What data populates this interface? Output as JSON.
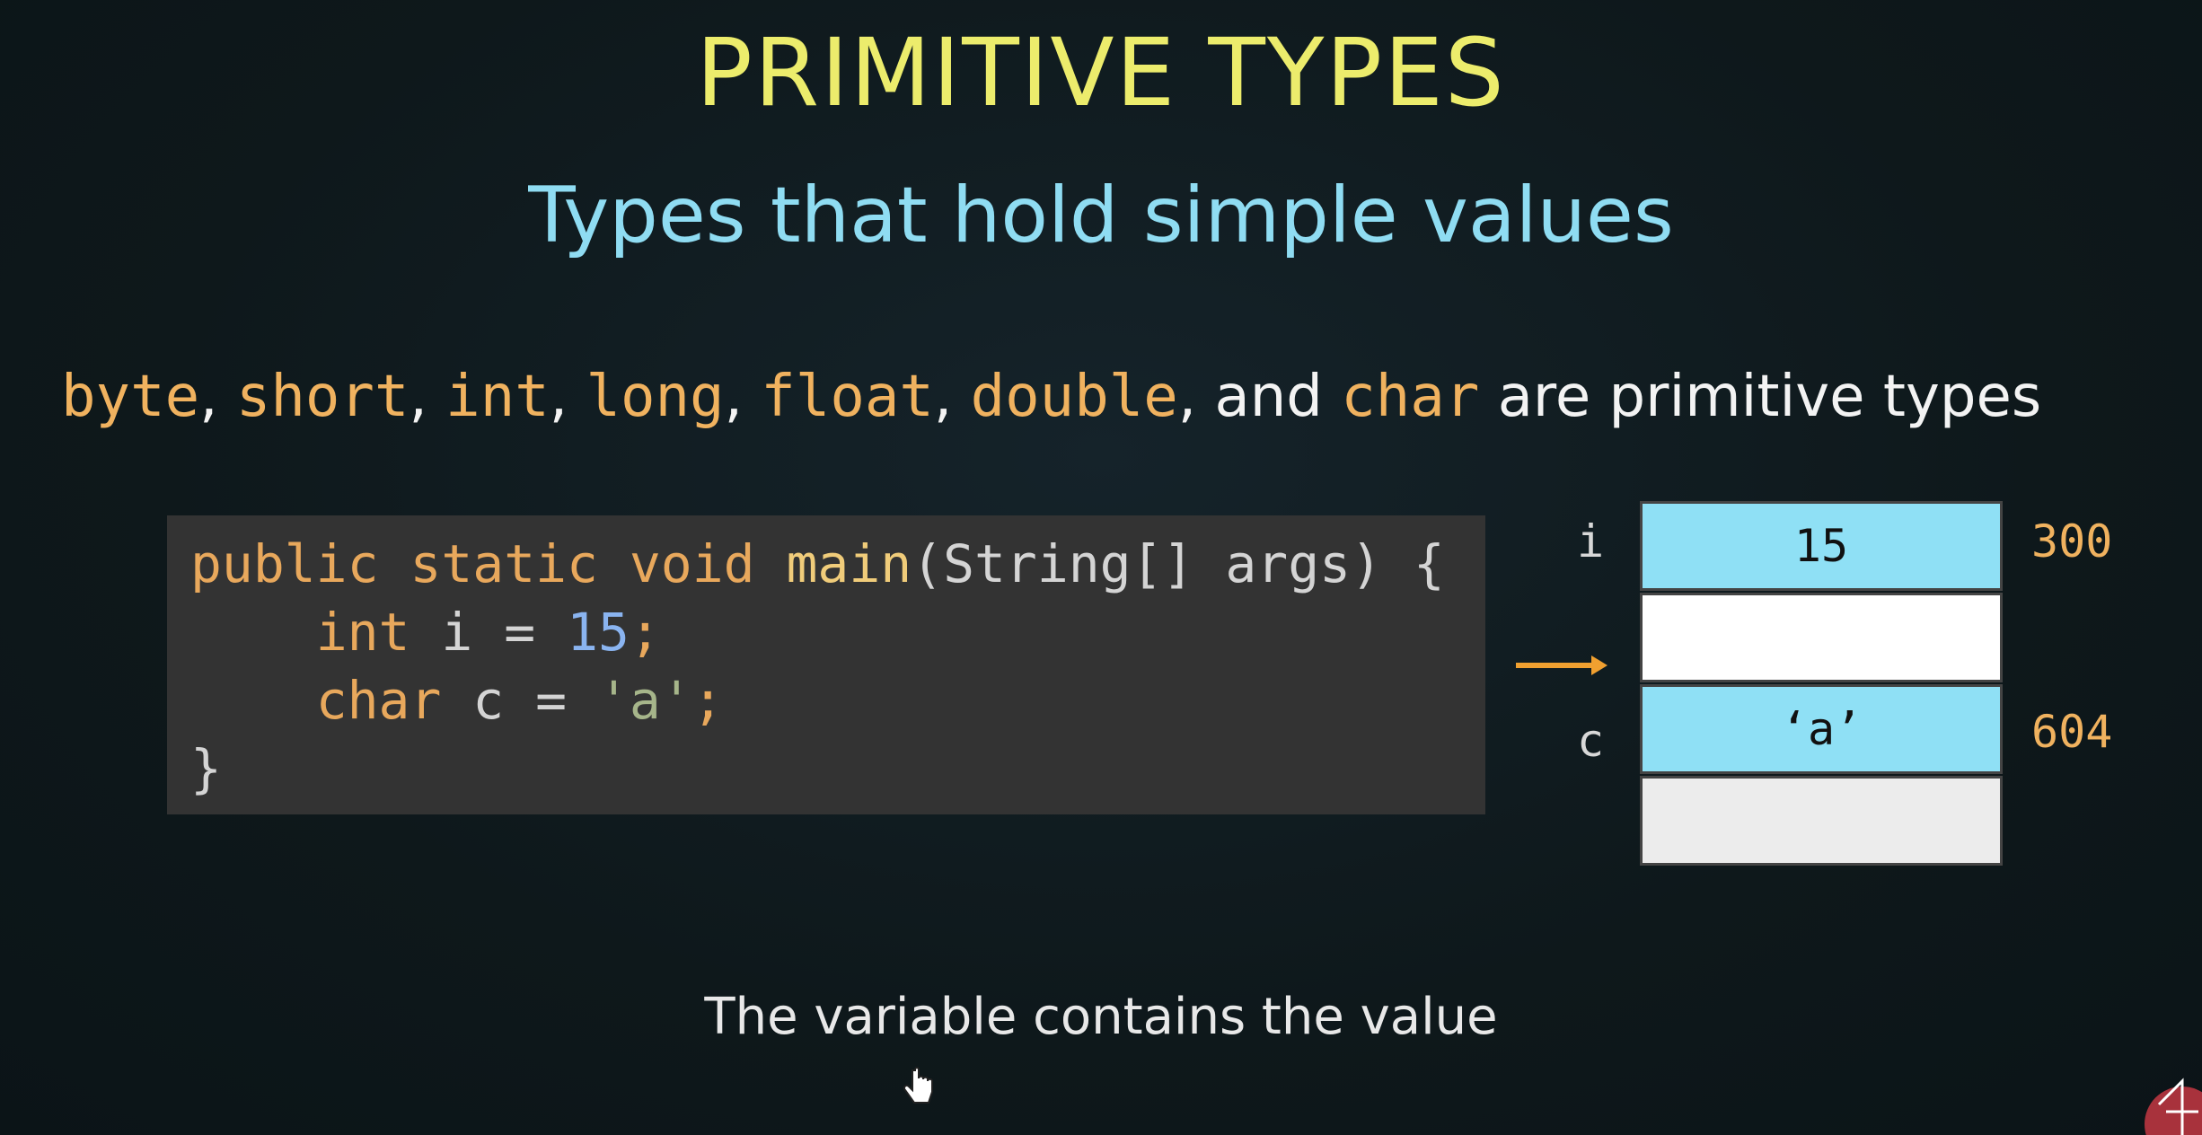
{
  "slide": {
    "title": "PRIMITIVE TYPES",
    "subtitle": "Types that hold simple values",
    "types_line": {
      "keywords": [
        "byte",
        "short",
        "int",
        "long",
        "float",
        "double",
        "char"
      ],
      "sep": ", ",
      "and": " and ",
      "suffix": " are primitive types"
    },
    "code": {
      "line1": {
        "kw1": "public",
        "kw2": "static",
        "kw3": "void",
        "fn": "main",
        "rest": "(String[] args) {"
      },
      "line2": {
        "type": "int",
        "name": "i",
        "eq": " = ",
        "value": "15",
        "end": ";"
      },
      "line3": {
        "type": "char",
        "name": "c",
        "eq": " = ",
        "value": "'a'",
        "end": ";"
      },
      "line4": "}"
    },
    "memory": {
      "cells": [
        {
          "var": "i",
          "value": "15",
          "address": "300"
        },
        {
          "var": "",
          "value": "",
          "address": ""
        },
        {
          "var": "c",
          "value": "‘a’",
          "address": "604"
        },
        {
          "var": "",
          "value": "",
          "address": ""
        }
      ]
    },
    "caption": "The variable contains the value"
  },
  "colors": {
    "background": "#0f1a1d",
    "title": "#ecec6c",
    "subtitle": "#8fdcf2",
    "keyword": "#f0b25f",
    "memory_cell": "#8fe0f5",
    "arrow": "#f0a030"
  },
  "icons": [
    "arrow-right-icon",
    "hand-cursor-icon",
    "logo-icon"
  ]
}
